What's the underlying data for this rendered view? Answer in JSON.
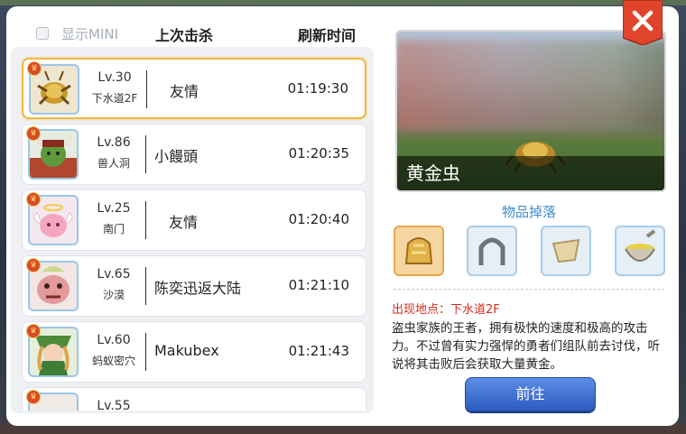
{
  "header": {
    "mini_label": "显示MINI",
    "col_last_kill": "上次击杀",
    "col_refresh": "刷新时间"
  },
  "bosses": [
    {
      "level": "Lv.30",
      "location": "下水道2F",
      "killer": "友情",
      "time": "01:19:30",
      "selected": true,
      "icon": "golden-bug-portrait"
    },
    {
      "level": "Lv.86",
      "location": "兽人洞",
      "killer": "小饅頭",
      "time": "01:20:35",
      "selected": false,
      "icon": "orc-hero-portrait"
    },
    {
      "level": "Lv.25",
      "location": "南门",
      "killer": "友情",
      "time": "01:20:40",
      "selected": false,
      "icon": "angeling-portrait"
    },
    {
      "level": "Lv.65",
      "location": "沙漠",
      "killer": "陈奕迅返大陆",
      "time": "01:21:10",
      "selected": false,
      "icon": "phreeoni-portrait"
    },
    {
      "level": "Lv.60",
      "location": "蚂蚁密穴",
      "killer": "Makubex",
      "time": "01:21:43",
      "selected": false,
      "icon": "maya-portrait"
    },
    {
      "level": "Lv.55",
      "location": "",
      "killer": "",
      "time": "",
      "selected": false,
      "icon": "boss-portrait"
    }
  ],
  "detail": {
    "name": "黄金虫",
    "drops_title": "物品掉落",
    "drops": [
      "golden-helm-icon",
      "horseshoe-icon",
      "cloth-piece-icon",
      "bowl-icon"
    ],
    "location_label": "出现地点：下水道2F",
    "description": "盗虫家族的王者，拥有极快的速度和极高的攻击力。不过曾有实力强悍的勇者们组队前去讨伐，听说将其击败后会获取大量黄金。",
    "go_button": "前往"
  },
  "close_icon": "close-icon",
  "colors": {
    "accent_blue": "#3d8bd0",
    "selected_border": "#f2b83b",
    "location_red": "#d22c1d",
    "close_red": "#e0452b"
  }
}
